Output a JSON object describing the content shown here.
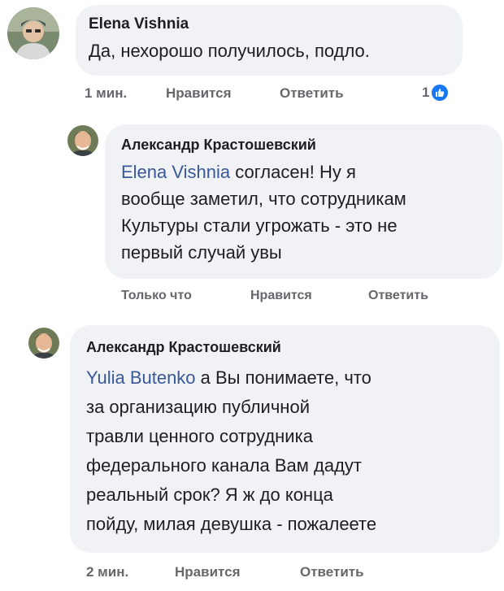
{
  "comments": [
    {
      "author": "Elena Vishnia",
      "mention": "",
      "text_lines": [
        "Да, нехорошо получилось, подло."
      ],
      "time": "1 мин.",
      "like_label": "Нравится",
      "reply_label": "Ответить",
      "reaction_count": "1",
      "reaction_icon": "like-thumbs-up-icon",
      "reaction_color": "#1877f2"
    },
    {
      "author": "Александр Крастошевский",
      "mention": "Elena Vishnia",
      "mention_suffix": " согласен! Ну я",
      "text_lines": [
        "вообще заметил, что сотрудникам",
        "Культуры стали угрожать - это не",
        "первый случай увы"
      ],
      "time": "Только что",
      "like_label": "Нравится",
      "reply_label": "Ответить"
    },
    {
      "author": "Александр Крастошевский",
      "mention": "Yulia Butenko",
      "mention_suffix": " а Вы понимаете, что",
      "text_lines": [
        "за организацию публичной",
        "травли ценного сотрудника",
        "федерального канала Вам дадут",
        "реальный срок? Я ж до конца",
        "пойду, милая девушка - пожалеете"
      ],
      "time": "2 мин.",
      "like_label": "Нравится",
      "reply_label": "Ответить"
    }
  ],
  "colors": {
    "bubble": "#f0f2f5",
    "mention": "#385898",
    "meta": "#65676b",
    "text": "#1c1e21"
  }
}
